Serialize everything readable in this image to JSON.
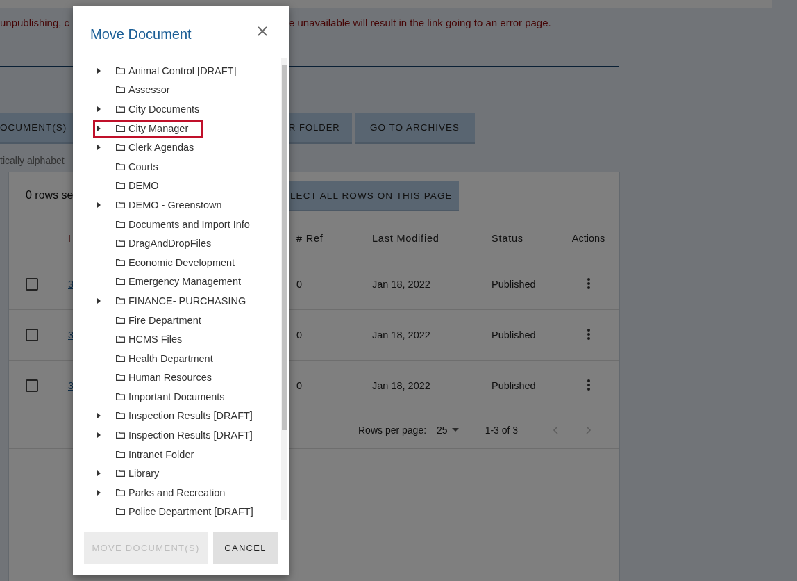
{
  "notice": {
    "before": "unpublishing, c",
    "after": "e unavailable will result in the link going to an error page."
  },
  "action_buttons": [
    "OCUMENT(S)",
    "R FOLDER",
    "GO TO ARCHIVES"
  ],
  "sort_note": "tically alphabet",
  "table": {
    "selection_count": "0 rows se",
    "select_all_button": "LECT ALL ROWS ON THIS PAGE",
    "columns": [
      "I",
      "# Ref",
      "Last Modified",
      "Status",
      "Actions"
    ],
    "rows": [
      {
        "checked": false,
        "id": "3",
        "ref": "0",
        "modified": "Jan 18, 2022",
        "status": "Published"
      },
      {
        "checked": false,
        "id": "3",
        "ref": "0",
        "modified": "Jan 18, 2022",
        "status": "Published"
      },
      {
        "checked": false,
        "id": "3",
        "ref": "0",
        "modified": "Jan 18, 2022",
        "status": "Published"
      }
    ],
    "pagination": {
      "rows_per_page_label": "Rows per page:",
      "rows_per_page": "25",
      "range": "1-3 of 3"
    }
  },
  "dialog": {
    "title": "Move Document",
    "folders": [
      {
        "name": "Animal Control [DRAFT]",
        "has_children": true,
        "selected": false
      },
      {
        "name": "Assessor",
        "has_children": false,
        "selected": false
      },
      {
        "name": "City Documents",
        "has_children": true,
        "selected": false
      },
      {
        "name": "City Manager",
        "has_children": true,
        "selected": true
      },
      {
        "name": "Clerk Agendas",
        "has_children": true,
        "selected": false
      },
      {
        "name": "Courts",
        "has_children": false,
        "selected": false
      },
      {
        "name": "DEMO",
        "has_children": false,
        "selected": false
      },
      {
        "name": "DEMO - Greenstown",
        "has_children": true,
        "selected": false
      },
      {
        "name": "Documents and Import Info",
        "has_children": false,
        "selected": false
      },
      {
        "name": "DragAndDropFiles",
        "has_children": false,
        "selected": false
      },
      {
        "name": "Economic Development",
        "has_children": false,
        "selected": false
      },
      {
        "name": "Emergency Management",
        "has_children": false,
        "selected": false
      },
      {
        "name": "FINANCE- PURCHASING",
        "has_children": true,
        "selected": false
      },
      {
        "name": "Fire Department",
        "has_children": false,
        "selected": false
      },
      {
        "name": "HCMS Files",
        "has_children": false,
        "selected": false
      },
      {
        "name": "Health Department",
        "has_children": false,
        "selected": false
      },
      {
        "name": "Human Resources",
        "has_children": false,
        "selected": false
      },
      {
        "name": "Important Documents",
        "has_children": false,
        "selected": false
      },
      {
        "name": "Inspection Results [DRAFT]",
        "has_children": true,
        "selected": false
      },
      {
        "name": "Inspection Results [DRAFT]",
        "has_children": true,
        "selected": false
      },
      {
        "name": "Intranet Folder",
        "has_children": false,
        "selected": false
      },
      {
        "name": "Library",
        "has_children": true,
        "selected": false
      },
      {
        "name": "Parks and Recreation",
        "has_children": true,
        "selected": false
      },
      {
        "name": "Police Department [DRAFT]",
        "has_children": false,
        "selected": false
      }
    ],
    "buttons": [
      {
        "label": "MOVE DOCUMENT(S)",
        "disabled": true
      },
      {
        "label": "CANCEL",
        "disabled": false
      }
    ]
  }
}
